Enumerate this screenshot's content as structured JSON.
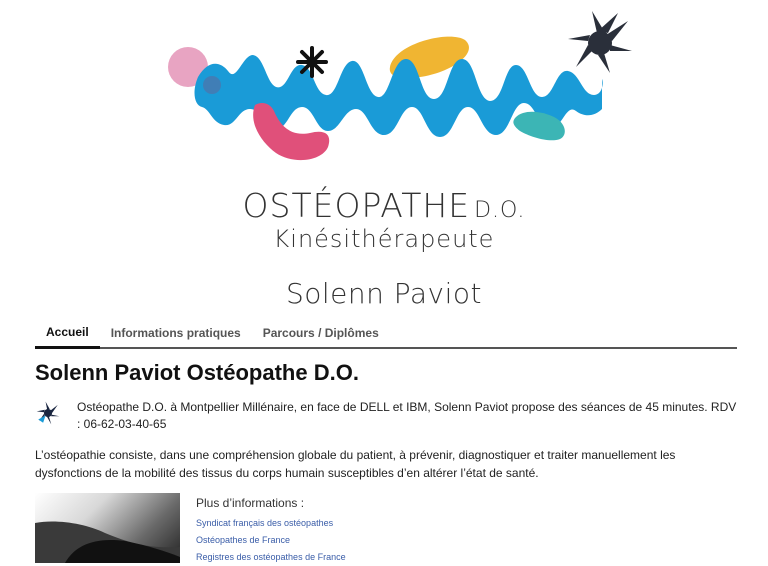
{
  "header": {
    "title_main": "OSTÉOPATHE",
    "title_suffix": "D.O.",
    "subtitle": "Kinésithérapeute",
    "name": "Solenn Paviot"
  },
  "nav": {
    "tabs": [
      {
        "label": "Accueil",
        "active": true
      },
      {
        "label": "Informations pratiques",
        "active": false
      },
      {
        "label": "Parcours / Diplômes",
        "active": false
      }
    ]
  },
  "main": {
    "heading": "Solenn Paviot Ostéopathe D.O.",
    "intro": "Ostéopathe D.O. à Montpellier Millénaire, en face de DELL et IBM, Solenn Paviot propose des séances de 45 minutes. RDV : 06-62-03-40-65",
    "body": "L’ostéopathie consiste, dans une compréhension globale du patient, à prévenir, diagnostiquer et traiter manuellement les dysfonctions de la mobilité des tissus du corps humain susceptibles d’en altérer l’état de santé."
  },
  "more_info": {
    "heading": "Plus d’informations :",
    "links": [
      "Syndicat français des ostéopathes",
      "Ostéopathes de France",
      "Registres des ostéopathes de France"
    ]
  },
  "colors": {
    "wave_blue": "#1a9bd7",
    "pink": "#e0507a",
    "light_pink": "#e8a4c2",
    "yellow": "#f0b532",
    "teal": "#3cb5b5",
    "dark_navy": "#222a3a",
    "link": "#3a5da8"
  }
}
